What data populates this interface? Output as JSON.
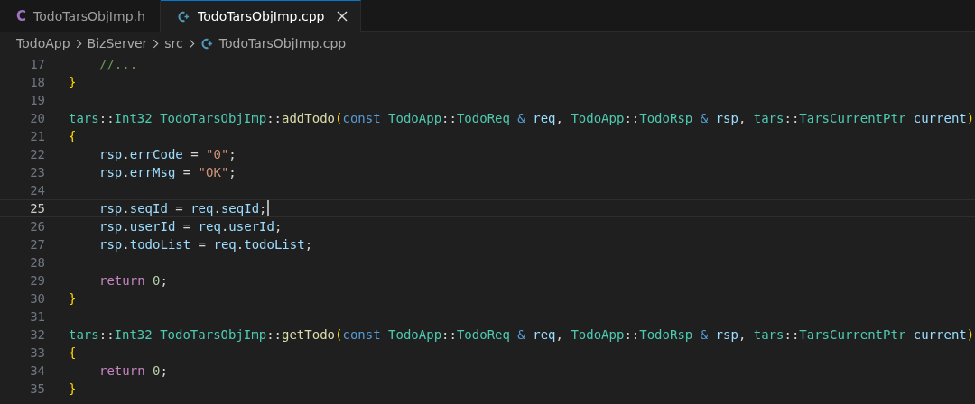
{
  "tabs": [
    {
      "icon": "C",
      "label": "TodoTarsObjImp.h",
      "kind": "header",
      "selected": false,
      "closable": false
    },
    {
      "label": "TodoTarsObjImp.cpp",
      "kind": "source",
      "selected": true,
      "closable": true
    }
  ],
  "breadcrumb": [
    {
      "label": "TodoApp",
      "kind": "folder"
    },
    {
      "label": "BizServer",
      "kind": "folder"
    },
    {
      "label": "src",
      "kind": "folder"
    },
    {
      "label": "TodoTarsObjImp.cpp",
      "kind": "source"
    }
  ],
  "lines": [
    {
      "number": "17",
      "current": false,
      "indented": true,
      "tokens": [
        {
          "kind": "comment",
          "text": "//..."
        }
      ]
    },
    {
      "number": "18",
      "current": false,
      "indented": false,
      "tokens": [
        {
          "kind": "bracket",
          "text": "}"
        }
      ]
    },
    {
      "number": "19",
      "current": false
    },
    {
      "number": "20",
      "current": false,
      "indented": false,
      "tokens": [
        {
          "kind": "type",
          "text": "tars"
        },
        {
          "kind": "plain",
          "text": "::"
        },
        {
          "kind": "type",
          "text": "Int32 TodoTarsObjImp"
        },
        {
          "kind": "plain",
          "text": "::"
        },
        {
          "kind": "fn",
          "text": "addTodo"
        },
        {
          "kind": "bracket",
          "text": "("
        },
        {
          "kind": "kw",
          "text": "const"
        },
        {
          "kind": "type",
          "text": " TodoApp"
        },
        {
          "kind": "plain",
          "text": "::"
        },
        {
          "kind": "type",
          "text": "TodoReq"
        },
        {
          "kind": "kw",
          "text": " & "
        },
        {
          "kind": "var",
          "text": "req"
        },
        {
          "kind": "plain",
          "text": ", "
        },
        {
          "kind": "type",
          "text": "TodoApp"
        },
        {
          "kind": "plain",
          "text": "::"
        },
        {
          "kind": "type",
          "text": "TodoRsp"
        },
        {
          "kind": "kw",
          "text": " & "
        },
        {
          "kind": "var",
          "text": "rsp"
        },
        {
          "kind": "plain",
          "text": ", "
        },
        {
          "kind": "type",
          "text": "tars"
        },
        {
          "kind": "plain",
          "text": "::"
        },
        {
          "kind": "type",
          "text": "TarsCurrentPtr"
        },
        {
          "kind": "var",
          "text": " current"
        },
        {
          "kind": "bracket",
          "text": ")"
        }
      ]
    },
    {
      "number": "21",
      "current": false,
      "indented": false,
      "tokens": [
        {
          "kind": "bracket",
          "text": "{"
        }
      ]
    },
    {
      "number": "22",
      "current": false,
      "indented": true,
      "tokens": [
        {
          "kind": "var",
          "text": "rsp"
        },
        {
          "kind": "plain",
          "text": "."
        },
        {
          "kind": "var",
          "text": "errCode"
        },
        {
          "kind": "plain",
          "text": " = "
        },
        {
          "kind": "str",
          "text": "\"0\""
        },
        {
          "kind": "plain",
          "text": ";"
        }
      ]
    },
    {
      "number": "23",
      "current": false,
      "indented": true,
      "tokens": [
        {
          "kind": "var",
          "text": "rsp"
        },
        {
          "kind": "plain",
          "text": "."
        },
        {
          "kind": "var",
          "text": "errMsg"
        },
        {
          "kind": "plain",
          "text": " = "
        },
        {
          "kind": "str",
          "text": "\"OK\""
        },
        {
          "kind": "plain",
          "text": ";"
        }
      ]
    },
    {
      "number": "24",
      "current": false
    },
    {
      "number": "25",
      "current": true,
      "indented": true,
      "tokens": [
        {
          "kind": "var",
          "text": "rsp"
        },
        {
          "kind": "plain",
          "text": "."
        },
        {
          "kind": "var",
          "text": "seqId"
        },
        {
          "kind": "plain",
          "text": " = "
        },
        {
          "kind": "var",
          "text": "req"
        },
        {
          "kind": "plain",
          "text": "."
        },
        {
          "kind": "var",
          "text": "seqId"
        },
        {
          "kind": "plain",
          "text": ";"
        }
      ]
    },
    {
      "number": "26",
      "current": false,
      "indented": true,
      "tokens": [
        {
          "kind": "var",
          "text": "rsp"
        },
        {
          "kind": "plain",
          "text": "."
        },
        {
          "kind": "var",
          "text": "userId"
        },
        {
          "kind": "plain",
          "text": " = "
        },
        {
          "kind": "var",
          "text": "req"
        },
        {
          "kind": "plain",
          "text": "."
        },
        {
          "kind": "var",
          "text": "userId"
        },
        {
          "kind": "plain",
          "text": ";"
        }
      ]
    },
    {
      "number": "27",
      "current": false,
      "indented": true,
      "tokens": [
        {
          "kind": "var",
          "text": "rsp"
        },
        {
          "kind": "plain",
          "text": "."
        },
        {
          "kind": "var",
          "text": "todoList"
        },
        {
          "kind": "plain",
          "text": " = "
        },
        {
          "kind": "var",
          "text": "req"
        },
        {
          "kind": "plain",
          "text": "."
        },
        {
          "kind": "var",
          "text": "todoList"
        },
        {
          "kind": "plain",
          "text": ";"
        }
      ]
    },
    {
      "number": "28",
      "current": false
    },
    {
      "number": "29",
      "current": false,
      "indented": true,
      "tokens": [
        {
          "kind": "ctrl",
          "text": "return"
        },
        {
          "kind": "num",
          "text": " 0"
        },
        {
          "kind": "plain",
          "text": ";"
        }
      ]
    },
    {
      "number": "30",
      "current": false,
      "indented": false,
      "tokens": [
        {
          "kind": "bracket",
          "text": "}"
        }
      ]
    },
    {
      "number": "31",
      "current": false
    },
    {
      "number": "32",
      "current": false,
      "indented": false,
      "tokens": [
        {
          "kind": "type",
          "text": "tars"
        },
        {
          "kind": "plain",
          "text": "::"
        },
        {
          "kind": "type",
          "text": "Int32 TodoTarsObjImp"
        },
        {
          "kind": "plain",
          "text": "::"
        },
        {
          "kind": "fn",
          "text": "getTodo"
        },
        {
          "kind": "bracket",
          "text": "("
        },
        {
          "kind": "kw",
          "text": "const"
        },
        {
          "kind": "type",
          "text": " TodoApp"
        },
        {
          "kind": "plain",
          "text": "::"
        },
        {
          "kind": "type",
          "text": "TodoReq"
        },
        {
          "kind": "kw",
          "text": " & "
        },
        {
          "kind": "var",
          "text": "req"
        },
        {
          "kind": "plain",
          "text": ", "
        },
        {
          "kind": "type",
          "text": "TodoApp"
        },
        {
          "kind": "plain",
          "text": "::"
        },
        {
          "kind": "type",
          "text": "TodoRsp"
        },
        {
          "kind": "kw",
          "text": " & "
        },
        {
          "kind": "var",
          "text": "rsp"
        },
        {
          "kind": "plain",
          "text": ", "
        },
        {
          "kind": "type",
          "text": "tars"
        },
        {
          "kind": "plain",
          "text": "::"
        },
        {
          "kind": "type",
          "text": "TarsCurrentPtr"
        },
        {
          "kind": "var",
          "text": " current"
        },
        {
          "kind": "bracket",
          "text": ")"
        }
      ]
    },
    {
      "number": "33",
      "current": false,
      "indented": false,
      "tokens": [
        {
          "kind": "bracket",
          "text": "{"
        }
      ]
    },
    {
      "number": "34",
      "current": false,
      "indented": true,
      "tokens": [
        {
          "kind": "ctrl",
          "text": "return"
        },
        {
          "kind": "num",
          "text": " 0"
        },
        {
          "kind": "plain",
          "text": ";"
        }
      ]
    },
    {
      "number": "35",
      "current": false,
      "indented": false,
      "tokens": [
        {
          "kind": "bracket",
          "text": "}"
        }
      ]
    }
  ]
}
